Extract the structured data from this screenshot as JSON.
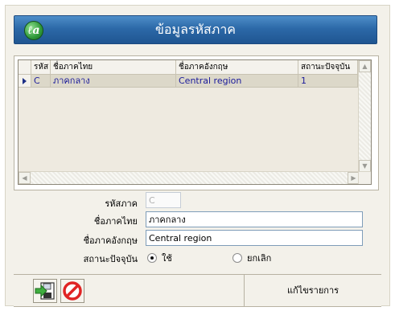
{
  "window": {
    "title": "ข้อมูลรหัสภาค"
  },
  "app_icon_glyph": "ℓa",
  "grid": {
    "columns": [
      "รหัส",
      "ชื่อภาคไทย",
      "ชื่อภาคอังกฤษ",
      "สถานะปัจจุบัน"
    ],
    "rows": [
      {
        "code": "C",
        "name_th": "ภาคกลาง",
        "name_en": "Central region",
        "status": "1"
      }
    ]
  },
  "form": {
    "code_label": "รหัสภาค",
    "code_value": "C",
    "name_th_label": "ชื่อภาคไทย",
    "name_th_value": "ภาคกลาง",
    "name_en_label": "ชื่อภาคอังกฤษ",
    "name_en_value": "Central region",
    "status_label": "สถานะปัจจุบัน",
    "status_options": [
      "ใช้",
      "ยกเลิก"
    ],
    "status_selected": "ใช้"
  },
  "toolbar": {
    "save_icon": "save-arrow-icon",
    "cancel_icon": "cancel-icon"
  },
  "status_bar": {
    "mode_text": "แก้ไขรายการ"
  },
  "colors": {
    "title_bar": "#2c69a8",
    "grid_text": "#1a1a9a",
    "selected_row": "#dcd8c9",
    "cancel_red": "#e02424",
    "save_green": "#3fae3f"
  }
}
